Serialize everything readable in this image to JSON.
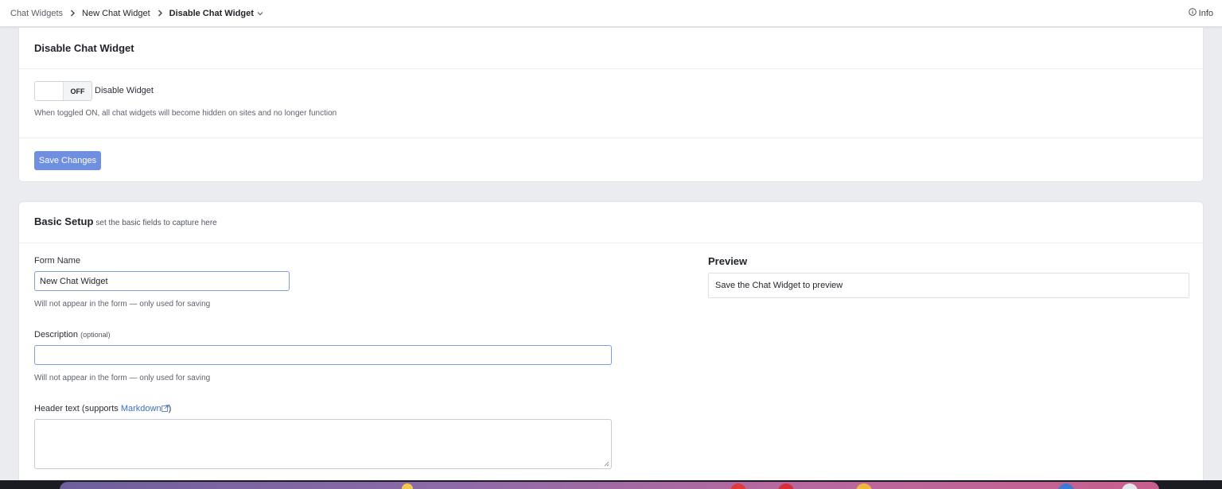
{
  "breadcrumb": {
    "items": [
      "Chat Widgets",
      "New Chat Widget",
      "Disable Chat Widget"
    ]
  },
  "topbar": {
    "info_label": "Info"
  },
  "disable_card": {
    "title": "Disable Chat Widget",
    "toggle_state": "OFF",
    "toggle_label": "Disable Widget",
    "help_text": "When toggled ON, all chat widgets will become hidden on sites and no longer function",
    "save_label": "Save Changes"
  },
  "basic_setup": {
    "title": "Basic Setup",
    "subtitle": "set the basic fields to capture here",
    "form_name": {
      "label": "Form Name",
      "value": "New Chat Widget",
      "help": "Will not appear in the form — only used for saving"
    },
    "description": {
      "label": "Description",
      "optional": "(optional)",
      "value": "",
      "help": "Will not appear in the form — only used for saving"
    },
    "header_text": {
      "label_prefix": "Header text (supports ",
      "link": "Markdown",
      "label_suffix": ")"
    },
    "preview": {
      "title": "Preview",
      "text": "Save the Chat Widget to preview"
    }
  },
  "colors": {
    "primary_button": "#6f8fe0",
    "link": "#3b6ed1",
    "page_bg": "#ebecef"
  }
}
